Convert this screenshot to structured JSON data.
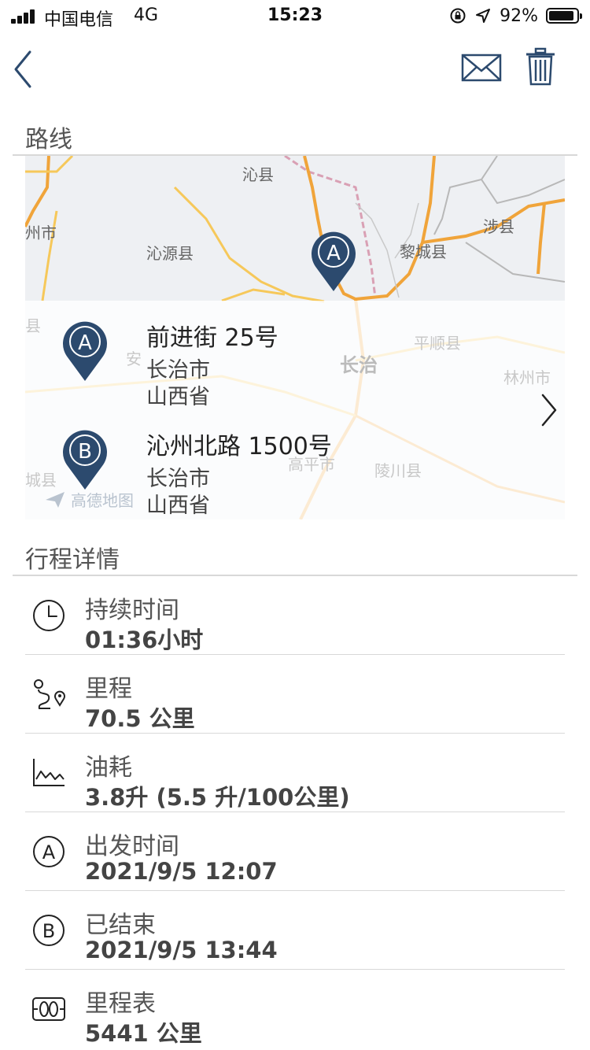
{
  "status_bar": {
    "carrier": "中国电信",
    "network": "4G",
    "time": "15:23",
    "battery_percent": "92%",
    "battery_level": 0.92
  },
  "nav": {
    "back_icon": "chevron-left-icon",
    "mail_icon": "envelope-icon",
    "delete_icon": "trash-icon",
    "accent_color": "#2c4a6e"
  },
  "route": {
    "section_title": "路线",
    "map_labels": [
      "沁县",
      "州市",
      "沁源县",
      "黎城县",
      "涉县",
      "县",
      "安",
      "长治",
      "平顺县",
      "林州市",
      "高平市",
      "陵川县",
      "城县"
    ],
    "watermark": "高德地图",
    "start": {
      "marker": "A",
      "street": "前进街 25号",
      "city": "长治市",
      "province": "山西省"
    },
    "end": {
      "marker": "B",
      "street": "沁州北路 1500号",
      "city": "长治市",
      "province": "山西省"
    }
  },
  "details": {
    "section_title": "行程详情",
    "rows": [
      {
        "icon": "clock-icon",
        "label": "持续时间",
        "value": "01:36小时"
      },
      {
        "icon": "route-icon",
        "label": "里程",
        "value": "70.5 公里"
      },
      {
        "icon": "fuel-chart-icon",
        "label": "油耗",
        "value": "3.8升 (5.5 升/100公里)"
      },
      {
        "icon": "circle-a-icon",
        "label": "出发时间",
        "value": "2021/9/5 12:07"
      },
      {
        "icon": "circle-b-icon",
        "label": "已结束",
        "value": "2021/9/5 13:44"
      },
      {
        "icon": "odometer-icon",
        "label": "里程表",
        "value": "5441 公里"
      }
    ]
  }
}
